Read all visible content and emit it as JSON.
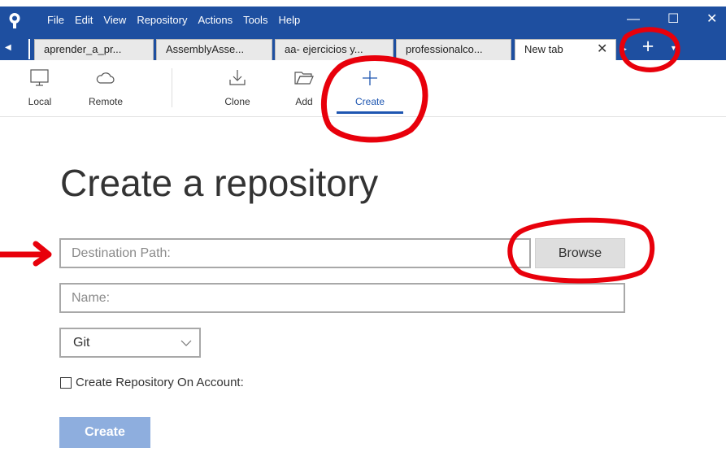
{
  "menubar": {
    "items": [
      "File",
      "Edit",
      "View",
      "Repository",
      "Actions",
      "Tools",
      "Help"
    ]
  },
  "window_controls": {
    "minimize": "—",
    "maximize": "☐",
    "close": "✕"
  },
  "tabs": [
    {
      "label": "aprender_a_pr..."
    },
    {
      "label": "AssemblyAsse..."
    },
    {
      "label": "aa- ejercicios y..."
    },
    {
      "label": "professionalco..."
    },
    {
      "label": "New tab",
      "active": true
    }
  ],
  "tab_controls": {
    "close": "✕",
    "add": "+"
  },
  "toolbar": {
    "local": "Local",
    "remote": "Remote",
    "clone": "Clone",
    "add": "Add",
    "create": "Create",
    "selected": "Create"
  },
  "main": {
    "title": "Create a repository",
    "destination_placeholder": "Destination Path:",
    "browse_label": "Browse",
    "name_placeholder": "Name:",
    "repo_type": "Git",
    "create_on_account_label": "Create Repository On Account:",
    "create_button": "Create"
  },
  "colors": {
    "titlebar": "#1e4fa0",
    "accent": "#1e56b1",
    "create_button": "#8eaede",
    "annotation": "#e8000b"
  }
}
